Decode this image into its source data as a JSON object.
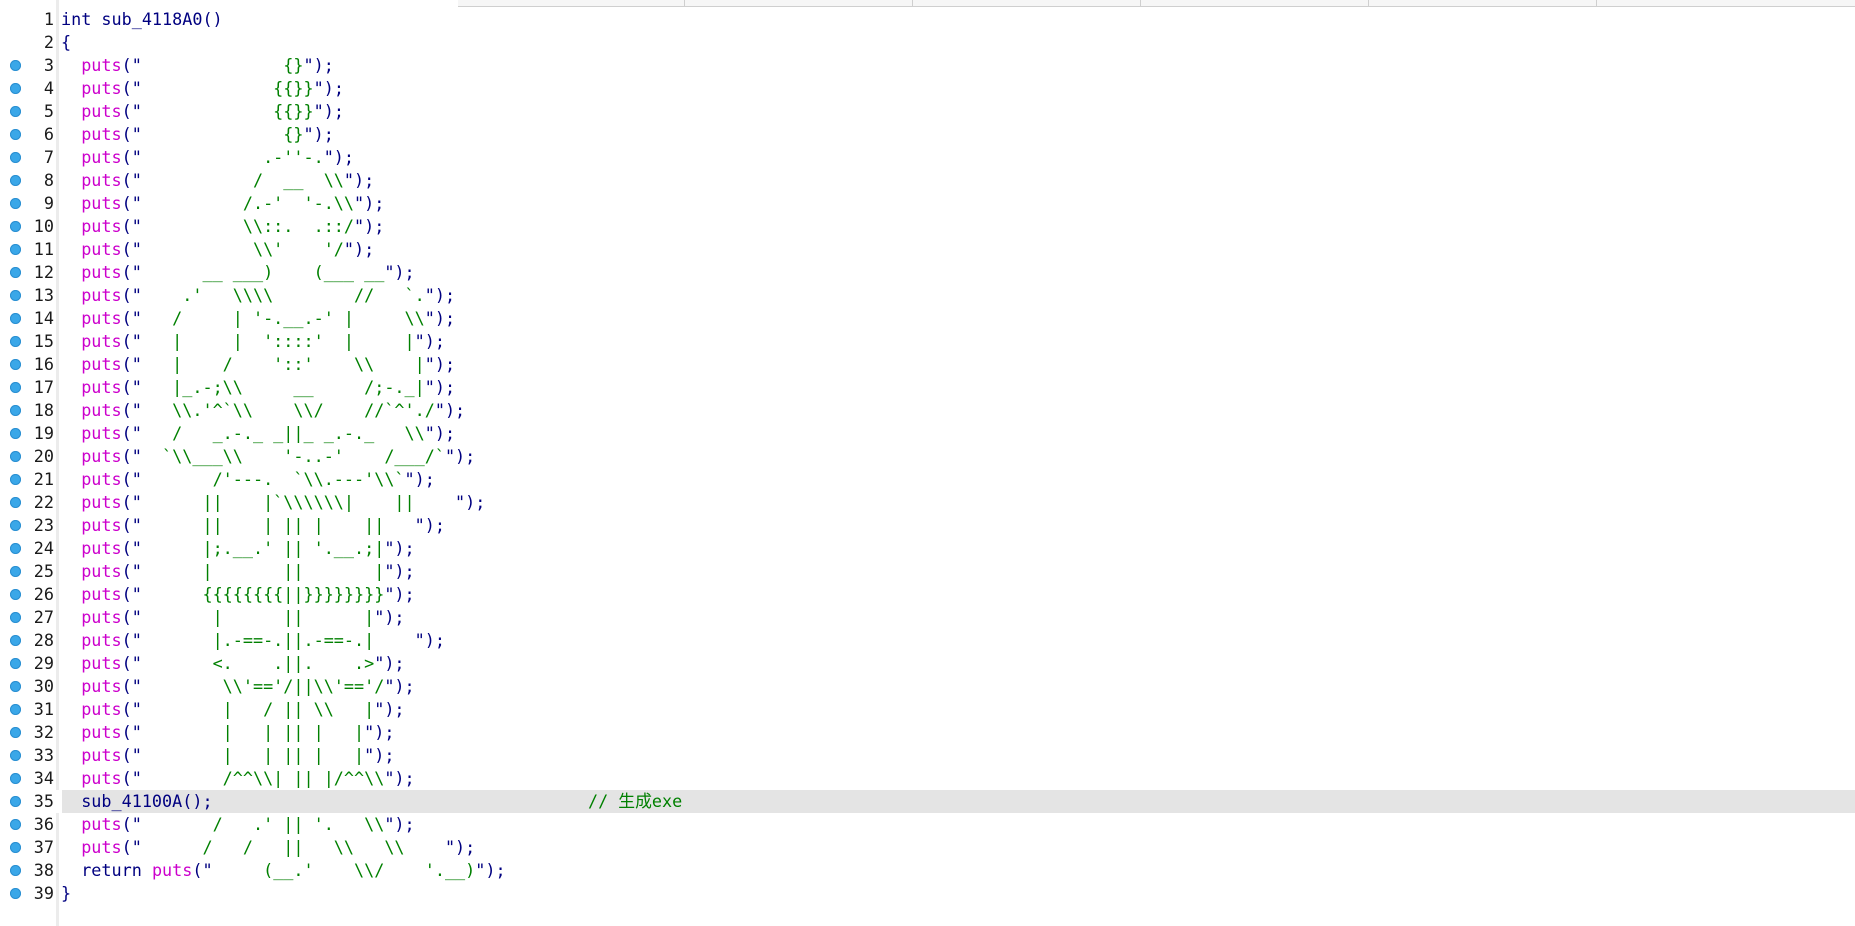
{
  "editor": {
    "highlighted_line": 35,
    "lines": [
      {
        "n": "1",
        "bp": false,
        "parts": [
          {
            "c": "kw",
            "t": "int sub_4118A0()"
          }
        ]
      },
      {
        "n": "2",
        "bp": false,
        "parts": [
          {
            "c": "pu",
            "t": "{"
          }
        ]
      },
      {
        "n": "3",
        "bp": true,
        "parts": [
          {
            "c": "fn",
            "t": "  puts"
          },
          {
            "c": "pu",
            "t": "(\""
          },
          {
            "c": "st",
            "t": "              {}"
          },
          {
            "c": "pu",
            "t": "\");"
          }
        ]
      },
      {
        "n": "4",
        "bp": true,
        "parts": [
          {
            "c": "fn",
            "t": "  puts"
          },
          {
            "c": "pu",
            "t": "(\""
          },
          {
            "c": "st",
            "t": "             {{}}"
          },
          {
            "c": "pu",
            "t": "\");"
          }
        ]
      },
      {
        "n": "5",
        "bp": true,
        "parts": [
          {
            "c": "fn",
            "t": "  puts"
          },
          {
            "c": "pu",
            "t": "(\""
          },
          {
            "c": "st",
            "t": "             {{}}"
          },
          {
            "c": "pu",
            "t": "\");"
          }
        ]
      },
      {
        "n": "6",
        "bp": true,
        "parts": [
          {
            "c": "fn",
            "t": "  puts"
          },
          {
            "c": "pu",
            "t": "(\""
          },
          {
            "c": "st",
            "t": "              {}"
          },
          {
            "c": "pu",
            "t": "\");"
          }
        ]
      },
      {
        "n": "7",
        "bp": true,
        "parts": [
          {
            "c": "fn",
            "t": "  puts"
          },
          {
            "c": "pu",
            "t": "(\""
          },
          {
            "c": "st",
            "t": "            .-''-."
          },
          {
            "c": "pu",
            "t": "\");"
          }
        ]
      },
      {
        "n": "8",
        "bp": true,
        "parts": [
          {
            "c": "fn",
            "t": "  puts"
          },
          {
            "c": "pu",
            "t": "(\""
          },
          {
            "c": "st",
            "t": "           /  __  \\\\"
          },
          {
            "c": "pu",
            "t": "\");"
          }
        ]
      },
      {
        "n": "9",
        "bp": true,
        "parts": [
          {
            "c": "fn",
            "t": "  puts"
          },
          {
            "c": "pu",
            "t": "(\""
          },
          {
            "c": "st",
            "t": "          /.-'  '-.\\\\"
          },
          {
            "c": "pu",
            "t": "\");"
          }
        ]
      },
      {
        "n": "10",
        "bp": true,
        "parts": [
          {
            "c": "fn",
            "t": "  puts"
          },
          {
            "c": "pu",
            "t": "(\""
          },
          {
            "c": "st",
            "t": "          \\\\::.  .::/"
          },
          {
            "c": "pu",
            "t": "\");"
          }
        ]
      },
      {
        "n": "11",
        "bp": true,
        "parts": [
          {
            "c": "fn",
            "t": "  puts"
          },
          {
            "c": "pu",
            "t": "(\""
          },
          {
            "c": "st",
            "t": "           \\\\'    '/"
          },
          {
            "c": "pu",
            "t": "\");"
          }
        ]
      },
      {
        "n": "12",
        "bp": true,
        "parts": [
          {
            "c": "fn",
            "t": "  puts"
          },
          {
            "c": "pu",
            "t": "(\""
          },
          {
            "c": "st",
            "t": "      __ ___)    (___ __"
          },
          {
            "c": "pu",
            "t": "\");"
          }
        ]
      },
      {
        "n": "13",
        "bp": true,
        "parts": [
          {
            "c": "fn",
            "t": "  puts"
          },
          {
            "c": "pu",
            "t": "(\""
          },
          {
            "c": "st",
            "t": "    .'   \\\\\\\\        //   `."
          },
          {
            "c": "pu",
            "t": "\");"
          }
        ]
      },
      {
        "n": "14",
        "bp": true,
        "parts": [
          {
            "c": "fn",
            "t": "  puts"
          },
          {
            "c": "pu",
            "t": "(\""
          },
          {
            "c": "st",
            "t": "   /     | '-.__.-' |     \\\\"
          },
          {
            "c": "pu",
            "t": "\");"
          }
        ]
      },
      {
        "n": "15",
        "bp": true,
        "parts": [
          {
            "c": "fn",
            "t": "  puts"
          },
          {
            "c": "pu",
            "t": "(\""
          },
          {
            "c": "st",
            "t": "   |     |  '::::'  |     |"
          },
          {
            "c": "pu",
            "t": "\");"
          }
        ]
      },
      {
        "n": "16",
        "bp": true,
        "parts": [
          {
            "c": "fn",
            "t": "  puts"
          },
          {
            "c": "pu",
            "t": "(\""
          },
          {
            "c": "st",
            "t": "   |    /    '::'    \\\\    |"
          },
          {
            "c": "pu",
            "t": "\");"
          }
        ]
      },
      {
        "n": "17",
        "bp": true,
        "parts": [
          {
            "c": "fn",
            "t": "  puts"
          },
          {
            "c": "pu",
            "t": "(\""
          },
          {
            "c": "st",
            "t": "   |_.-;\\\\     __     /;-._|"
          },
          {
            "c": "pu",
            "t": "\");"
          }
        ]
      },
      {
        "n": "18",
        "bp": true,
        "parts": [
          {
            "c": "fn",
            "t": "  puts"
          },
          {
            "c": "pu",
            "t": "(\""
          },
          {
            "c": "st",
            "t": "   \\\\.'^`\\\\    \\\\/    //`^'./"
          },
          {
            "c": "pu",
            "t": "\");"
          }
        ]
      },
      {
        "n": "19",
        "bp": true,
        "parts": [
          {
            "c": "fn",
            "t": "  puts"
          },
          {
            "c": "pu",
            "t": "(\""
          },
          {
            "c": "st",
            "t": "   /   _.-._ _||_ _.-._   \\\\"
          },
          {
            "c": "pu",
            "t": "\");"
          }
        ]
      },
      {
        "n": "20",
        "bp": true,
        "parts": [
          {
            "c": "fn",
            "t": "  puts"
          },
          {
            "c": "pu",
            "t": "(\""
          },
          {
            "c": "st",
            "t": "  `\\\\___\\\\    '-..-'    /___/`"
          },
          {
            "c": "pu",
            "t": "\");"
          }
        ]
      },
      {
        "n": "21",
        "bp": true,
        "parts": [
          {
            "c": "fn",
            "t": "  puts"
          },
          {
            "c": "pu",
            "t": "(\""
          },
          {
            "c": "st",
            "t": "       /'---.  `\\\\.---'\\\\`"
          },
          {
            "c": "pu",
            "t": "\");"
          }
        ]
      },
      {
        "n": "22",
        "bp": true,
        "parts": [
          {
            "c": "fn",
            "t": "  puts"
          },
          {
            "c": "pu",
            "t": "(\""
          },
          {
            "c": "st",
            "t": "      ||    |`\\\\\\\\\\\\|    ||    "
          },
          {
            "c": "pu",
            "t": "\");"
          }
        ]
      },
      {
        "n": "23",
        "bp": true,
        "parts": [
          {
            "c": "fn",
            "t": "  puts"
          },
          {
            "c": "pu",
            "t": "(\""
          },
          {
            "c": "st",
            "t": "      ||    | || |    ||   "
          },
          {
            "c": "pu",
            "t": "\");"
          }
        ]
      },
      {
        "n": "24",
        "bp": true,
        "parts": [
          {
            "c": "fn",
            "t": "  puts"
          },
          {
            "c": "pu",
            "t": "(\""
          },
          {
            "c": "st",
            "t": "      |;.__.' || '.__.;|"
          },
          {
            "c": "pu",
            "t": "\");"
          }
        ]
      },
      {
        "n": "25",
        "bp": true,
        "parts": [
          {
            "c": "fn",
            "t": "  puts"
          },
          {
            "c": "pu",
            "t": "(\""
          },
          {
            "c": "st",
            "t": "      |       ||       |"
          },
          {
            "c": "pu",
            "t": "\");"
          }
        ]
      },
      {
        "n": "26",
        "bp": true,
        "parts": [
          {
            "c": "fn",
            "t": "  puts"
          },
          {
            "c": "pu",
            "t": "(\""
          },
          {
            "c": "st",
            "t": "      {{{{{{{{||}}}}}}}}"
          },
          {
            "c": "pu",
            "t": "\");"
          }
        ]
      },
      {
        "n": "27",
        "bp": true,
        "parts": [
          {
            "c": "fn",
            "t": "  puts"
          },
          {
            "c": "pu",
            "t": "(\""
          },
          {
            "c": "st",
            "t": "       |      ||      |"
          },
          {
            "c": "pu",
            "t": "\");"
          }
        ]
      },
      {
        "n": "28",
        "bp": true,
        "parts": [
          {
            "c": "fn",
            "t": "  puts"
          },
          {
            "c": "pu",
            "t": "(\""
          },
          {
            "c": "st",
            "t": "       |.-==-.||.-==-.|    "
          },
          {
            "c": "pu",
            "t": "\");"
          }
        ]
      },
      {
        "n": "29",
        "bp": true,
        "parts": [
          {
            "c": "fn",
            "t": "  puts"
          },
          {
            "c": "pu",
            "t": "(\""
          },
          {
            "c": "st",
            "t": "       <.    .||.    .>"
          },
          {
            "c": "pu",
            "t": "\");"
          }
        ]
      },
      {
        "n": "30",
        "bp": true,
        "parts": [
          {
            "c": "fn",
            "t": "  puts"
          },
          {
            "c": "pu",
            "t": "(\""
          },
          {
            "c": "st",
            "t": "        \\\\'=='/||\\\\'=='/"
          },
          {
            "c": "pu",
            "t": "\");"
          }
        ]
      },
      {
        "n": "31",
        "bp": true,
        "parts": [
          {
            "c": "fn",
            "t": "  puts"
          },
          {
            "c": "pu",
            "t": "(\""
          },
          {
            "c": "st",
            "t": "        |   / || \\\\   |"
          },
          {
            "c": "pu",
            "t": "\");"
          }
        ]
      },
      {
        "n": "32",
        "bp": true,
        "parts": [
          {
            "c": "fn",
            "t": "  puts"
          },
          {
            "c": "pu",
            "t": "(\""
          },
          {
            "c": "st",
            "t": "        |   | || |   |"
          },
          {
            "c": "pu",
            "t": "\");"
          }
        ]
      },
      {
        "n": "33",
        "bp": true,
        "parts": [
          {
            "c": "fn",
            "t": "  puts"
          },
          {
            "c": "pu",
            "t": "(\""
          },
          {
            "c": "st",
            "t": "        |   | || |   |"
          },
          {
            "c": "pu",
            "t": "\");"
          }
        ]
      },
      {
        "n": "34",
        "bp": true,
        "parts": [
          {
            "c": "fn",
            "t": "  puts"
          },
          {
            "c": "pu",
            "t": "(\""
          },
          {
            "c": "st",
            "t": "        /^^\\\\| || |/^^\\\\"
          },
          {
            "c": "pu",
            "t": "\");"
          }
        ]
      },
      {
        "n": "35",
        "bp": true,
        "parts": [
          {
            "c": "kw",
            "t": "  sub_41100A();"
          }
        ],
        "comment": "// 生成exe"
      },
      {
        "n": "36",
        "bp": true,
        "parts": [
          {
            "c": "fn",
            "t": "  puts"
          },
          {
            "c": "pu",
            "t": "(\""
          },
          {
            "c": "st",
            "t": "       /   .' || '.   \\\\"
          },
          {
            "c": "pu",
            "t": "\");"
          }
        ]
      },
      {
        "n": "37",
        "bp": true,
        "parts": [
          {
            "c": "fn",
            "t": "  puts"
          },
          {
            "c": "pu",
            "t": "(\""
          },
          {
            "c": "st",
            "t": "      /   /   ||   \\\\   \\\\    "
          },
          {
            "c": "pu",
            "t": "\");"
          }
        ]
      },
      {
        "n": "38",
        "bp": true,
        "parts": [
          {
            "c": "kw",
            "t": "  return "
          },
          {
            "c": "fn",
            "t": "puts"
          },
          {
            "c": "pu",
            "t": "(\""
          },
          {
            "c": "st",
            "t": "     (__.'    \\\\/    '.__)"
          },
          {
            "c": "pu",
            "t": "\");"
          }
        ]
      },
      {
        "n": "39",
        "bp": true,
        "parts": [
          {
            "c": "pu",
            "t": "}"
          }
        ]
      }
    ]
  }
}
